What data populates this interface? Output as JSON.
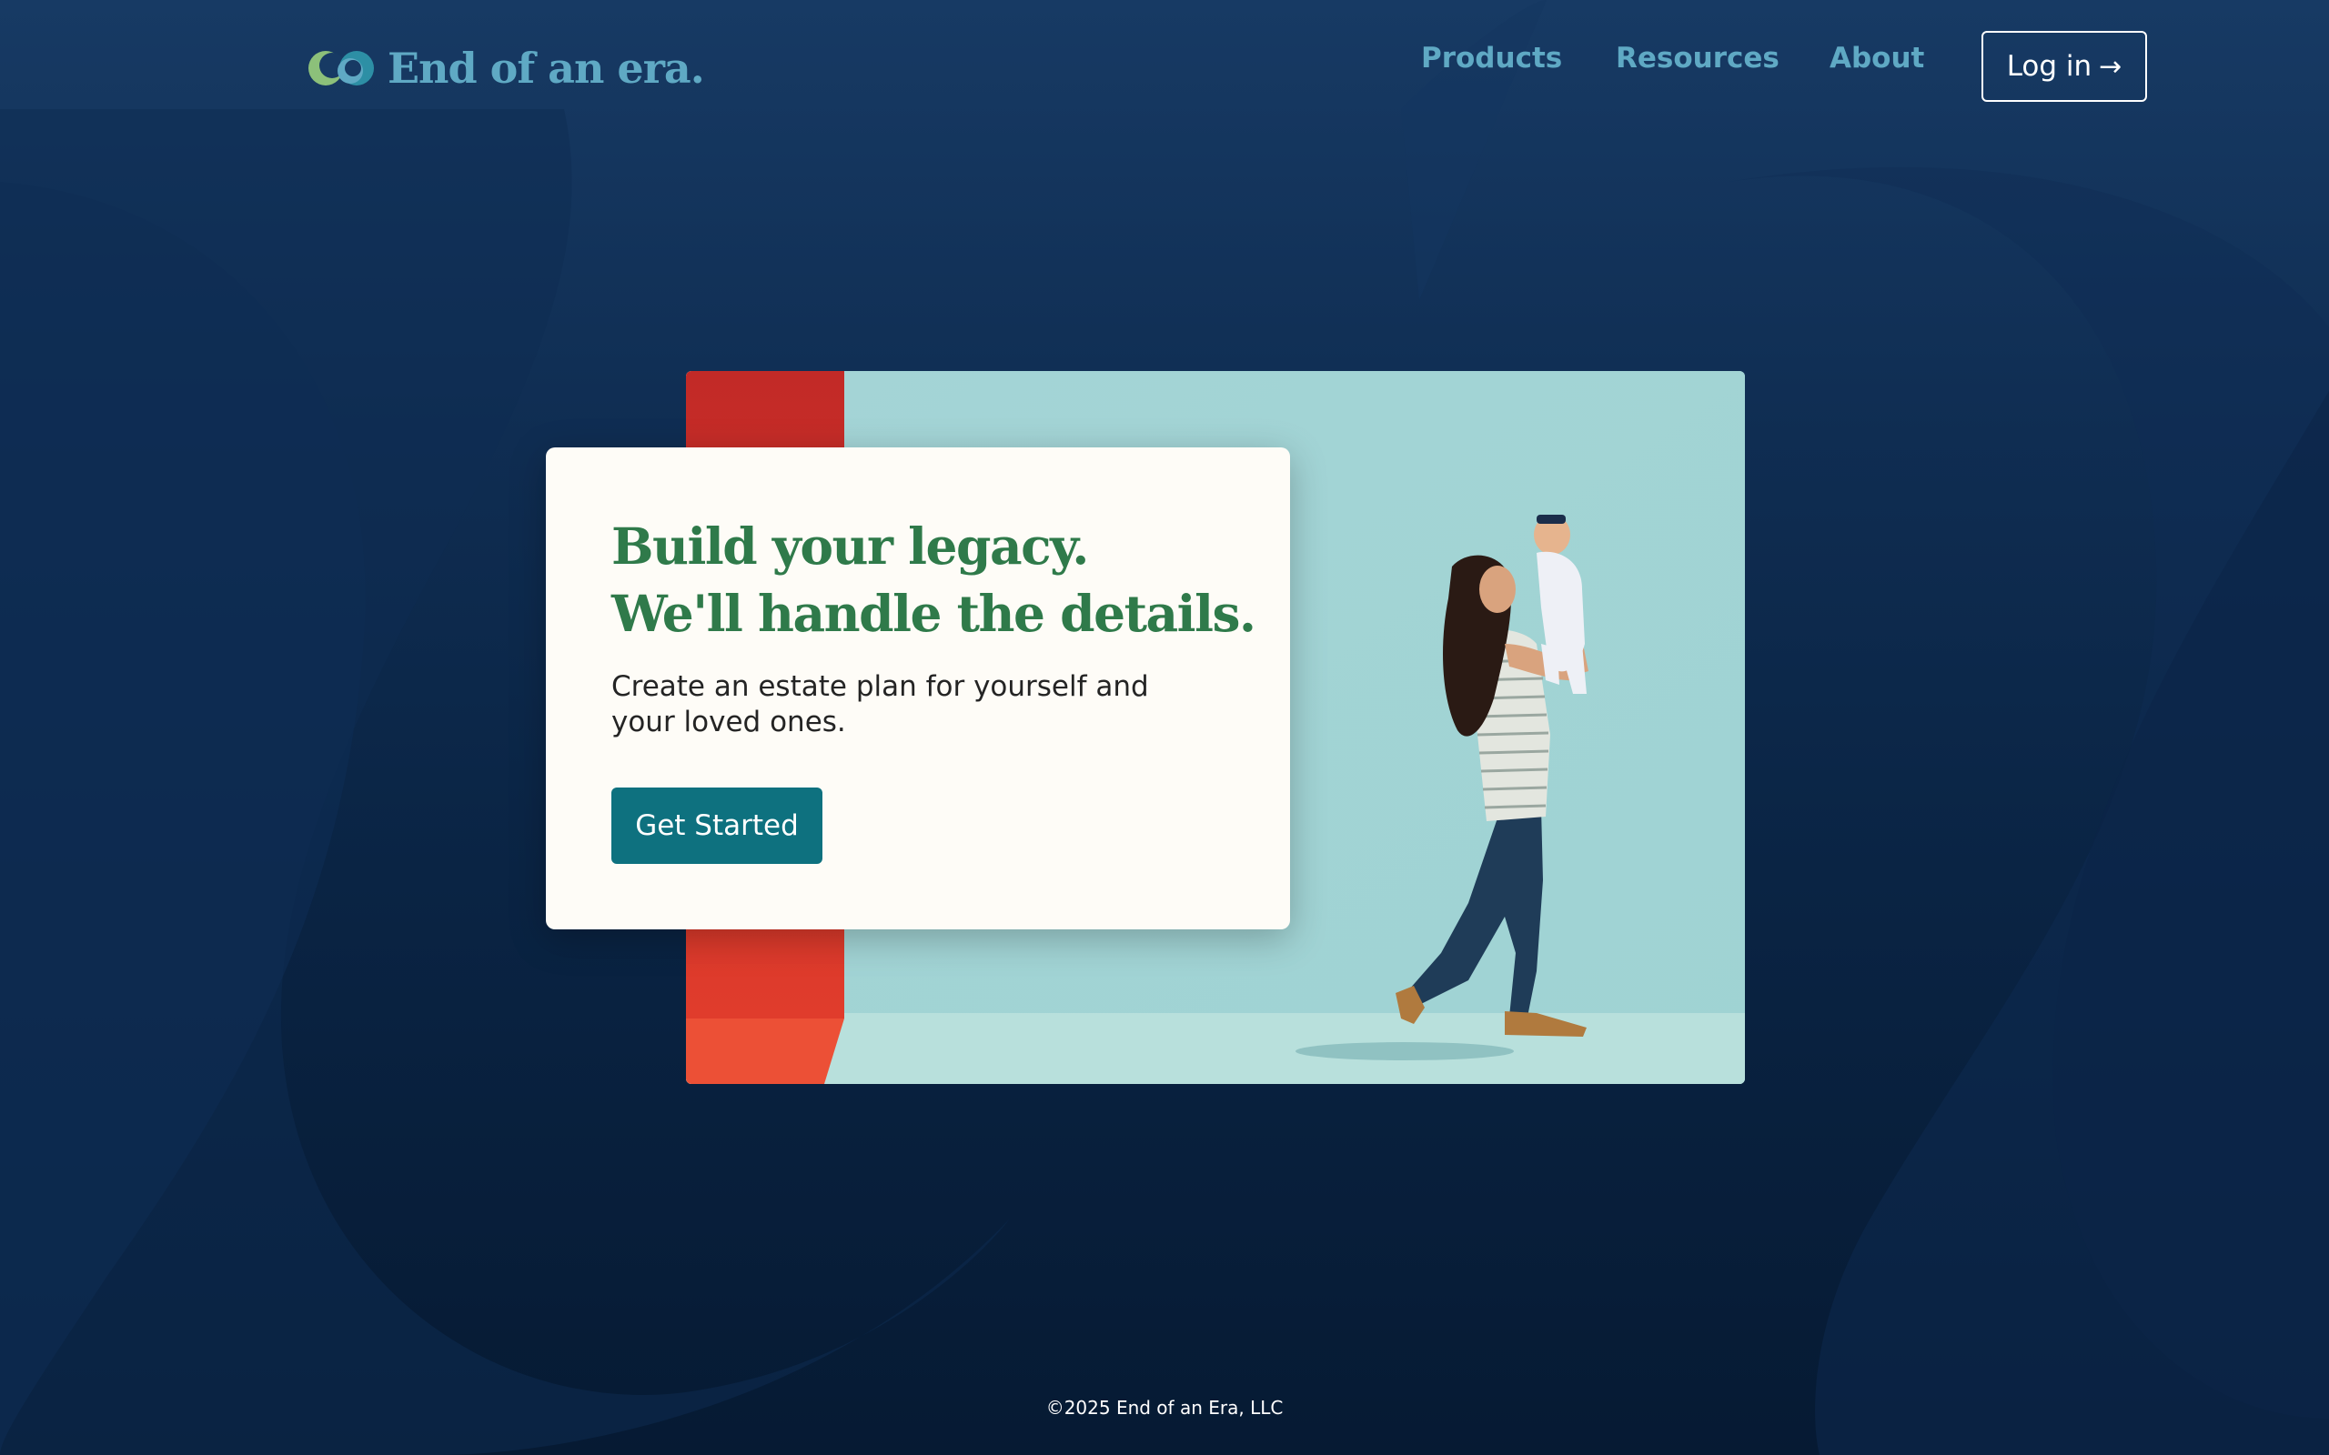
{
  "brand": {
    "name": "End of an era.",
    "colors": {
      "background_top": "#173a64",
      "background_bottom": "#061a33",
      "link": "#5fa9c4",
      "headline": "#2f7a4a",
      "cta": "#0e717f",
      "card": "#fefcf7",
      "logo_green": "#8cc07a",
      "logo_teal": "#2d8fa5"
    },
    "logo_icon": "infinity-loop-logo"
  },
  "nav": {
    "items": [
      {
        "label": "Products"
      },
      {
        "label": "Resources"
      },
      {
        "label": "About"
      }
    ],
    "login_label": "Log in",
    "login_icon": "arrow-right-icon"
  },
  "hero": {
    "title_line1": "Build your legacy.",
    "title_line2": "We'll handle the details.",
    "subtitle": "Create an estate plan for yourself and your loved ones.",
    "cta_label": "Get Started",
    "image": "mother-lifting-baby-photo"
  },
  "footer": {
    "copyright": "©2025 End of an Era, LLC"
  }
}
